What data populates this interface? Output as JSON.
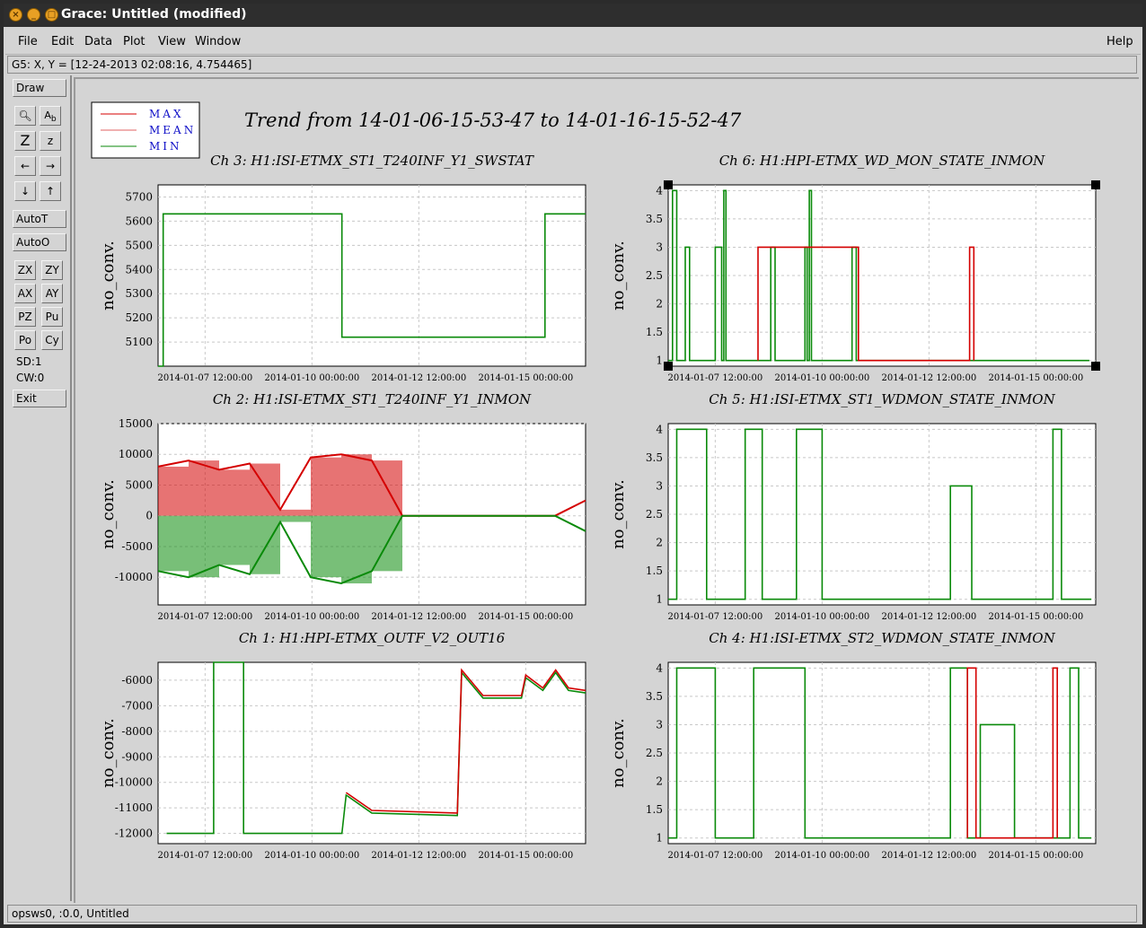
{
  "window": {
    "title": "Grace: Untitled (modified)"
  },
  "menubar": {
    "items": [
      {
        "label": "File",
        "key": "file"
      },
      {
        "label": "Edit",
        "key": "edit"
      },
      {
        "label": "Data",
        "key": "data"
      },
      {
        "label": "Plot",
        "key": "plot"
      },
      {
        "label": "View",
        "key": "view"
      },
      {
        "label": "Window",
        "key": "window"
      }
    ],
    "help": "Help"
  },
  "locator": {
    "text": "G5: X, Y = [12-24-2013 02:08:16, 4.754465]"
  },
  "toolbox": {
    "draw": "Draw",
    "autoT": "AutoT",
    "autoO": "AutoO",
    "grid_buttons": [
      "ZX",
      "ZY",
      "AX",
      "AY",
      "PZ",
      "Pu",
      "Po",
      "Cy"
    ],
    "sd": "SD:1",
    "cw": "CW:0",
    "exit": "Exit",
    "icons": [
      "zoom-icon",
      "text-label-icon",
      "zoom-in-icon",
      "zoom-out-icon",
      "pan-left-icon",
      "pan-right-icon",
      "pan-down-icon",
      "pan-up-icon"
    ]
  },
  "status": {
    "text": "opsws0, :0.0, Untitled"
  },
  "legend": {
    "entries": [
      {
        "name": "MAX",
        "color": "#d40000"
      },
      {
        "name": "MEAN",
        "color": "#e06060"
      },
      {
        "name": "MIN",
        "color": "#0a8a0a"
      }
    ]
  },
  "page_title": "Trend from 14-01-06-15-53-47 to 14-01-16-15-52-47",
  "chart_data": [
    {
      "type": "line",
      "title": "Ch 3: H1:ISI-ETMX_ST1_T240INF_Y1_SWSTAT",
      "ylabel": "no_conv.",
      "ylim": [
        5000,
        5750
      ],
      "yticks": [
        "5700",
        "5600",
        "5500",
        "5400",
        "5300",
        "5200",
        "5100"
      ],
      "xticks": [
        "2014-01-07 12:00:00",
        "2014-01-10 00:00:00",
        "2014-01-12 12:00:00",
        "2014-01-15 00:00:00"
      ],
      "series": [
        {
          "name": "MIN",
          "points": [
            [
              0,
              5000
            ],
            [
              0.012,
              5000
            ],
            [
              0.012,
              5630
            ],
            [
              0.43,
              5630
            ],
            [
              0.43,
              5120
            ],
            [
              0.905,
              5120
            ],
            [
              0.905,
              5630
            ],
            [
              1,
              5630
            ]
          ]
        }
      ]
    },
    {
      "type": "line",
      "title": "Ch 6: H1:HPI-ETMX_WD_MON_STATE_INMON",
      "ylabel": "no_conv.",
      "ylim": [
        0.9,
        4.1
      ],
      "yticks": [
        "4",
        "3.5",
        "3",
        "2.5",
        "2",
        "1.5",
        "1"
      ],
      "xticks": [
        "2014-01-07 12:00:00",
        "2014-01-10 00:00:00",
        "2014-01-12 12:00:00",
        "2014-01-15 00:00:00"
      ],
      "series": [
        {
          "name": "MIN",
          "points": [
            [
              0,
              1
            ],
            [
              0.01,
              1
            ],
            [
              0.01,
              4
            ],
            [
              0.02,
              4
            ],
            [
              0.02,
              1
            ],
            [
              0.04,
              1
            ],
            [
              0.04,
              3
            ],
            [
              0.05,
              3
            ],
            [
              0.05,
              1
            ],
            [
              0.11,
              1
            ],
            [
              0.11,
              3
            ],
            [
              0.125,
              3
            ],
            [
              0.125,
              1
            ],
            [
              0.13,
              1
            ],
            [
              0.13,
              4
            ],
            [
              0.135,
              4
            ],
            [
              0.135,
              1
            ],
            [
              0.24,
              1
            ],
            [
              0.24,
              3
            ],
            [
              0.25,
              3
            ],
            [
              0.25,
              1
            ],
            [
              0.32,
              1
            ],
            [
              0.32,
              3
            ],
            [
              0.325,
              3
            ],
            [
              0.325,
              1
            ],
            [
              0.33,
              1
            ],
            [
              0.33,
              4
            ],
            [
              0.335,
              4
            ],
            [
              0.335,
              1
            ],
            [
              0.43,
              1
            ],
            [
              0.43,
              3
            ],
            [
              0.44,
              3
            ],
            [
              0.44,
              1
            ],
            [
              0.985,
              1
            ]
          ]
        },
        {
          "name": "MAX",
          "points": [
            [
              0.21,
              1
            ],
            [
              0.21,
              3
            ],
            [
              0.445,
              3
            ],
            [
              0.445,
              1
            ],
            [
              0.705,
              1
            ],
            [
              0.705,
              3
            ],
            [
              0.715,
              3
            ],
            [
              0.715,
              1
            ]
          ]
        }
      ]
    },
    {
      "type": "line",
      "title": "Ch 2: H1:ISI-ETMX_ST1_T240INF_Y1_INMON",
      "ylabel": "no_conv.",
      "ylim": [
        -14500,
        15000
      ],
      "yticks": [
        "15000",
        "10000",
        "5000",
        "0",
        "-5000",
        "-10000"
      ],
      "xticks": [
        "2014-01-07 12:00:00",
        "2014-01-10 00:00:00",
        "2014-01-12 12:00:00",
        "2014-01-15 00:00:00"
      ],
      "series": [
        {
          "name": "MAX",
          "values": [
            8000,
            9000,
            7500,
            8500,
            1000,
            9500,
            10000,
            9000,
            0,
            0,
            0,
            0,
            0,
            0,
            2500
          ]
        },
        {
          "name": "MIN",
          "values": [
            -9000,
            -10000,
            -8000,
            -9500,
            -1000,
            -10000,
            -11000,
            -9000,
            0,
            0,
            0,
            0,
            0,
            0,
            -2500
          ]
        }
      ]
    },
    {
      "type": "line",
      "title": "Ch 5: H1:ISI-ETMX_ST1_WDMON_STATE_INMON",
      "ylabel": "no_conv.",
      "ylim": [
        0.9,
        4.1
      ],
      "yticks": [
        "4",
        "3.5",
        "3",
        "2.5",
        "2",
        "1.5",
        "1"
      ],
      "xticks": [
        "2014-01-07 12:00:00",
        "2014-01-10 00:00:00",
        "2014-01-12 12:00:00",
        "2014-01-15 00:00:00"
      ],
      "series": [
        {
          "name": "MIN",
          "points": [
            [
              0,
              1
            ],
            [
              0.02,
              1
            ],
            [
              0.02,
              4
            ],
            [
              0.09,
              4
            ],
            [
              0.09,
              1
            ],
            [
              0.18,
              1
            ],
            [
              0.18,
              4
            ],
            [
              0.22,
              4
            ],
            [
              0.22,
              1
            ],
            [
              0.3,
              1
            ],
            [
              0.3,
              4
            ],
            [
              0.36,
              4
            ],
            [
              0.36,
              1
            ],
            [
              0.66,
              1
            ],
            [
              0.66,
              3
            ],
            [
              0.71,
              3
            ],
            [
              0.71,
              1
            ],
            [
              0.9,
              1
            ],
            [
              0.9,
              4
            ],
            [
              0.92,
              4
            ],
            [
              0.92,
              1
            ],
            [
              0.99,
              1
            ]
          ]
        }
      ]
    },
    {
      "type": "line",
      "title": "Ch 1: H1:HPI-ETMX_OUTF_V2_OUT16",
      "ylabel": "no_conv.",
      "ylim": [
        -12400,
        -5300
      ],
      "yticks": [
        "-6000",
        "-7000",
        "-8000",
        "-9000",
        "-10000",
        "-11000",
        "-12000"
      ],
      "xticks": [
        "2014-01-07 12:00:00",
        "2014-01-10 00:00:00",
        "2014-01-12 12:00:00",
        "2014-01-15 00:00:00"
      ],
      "series": [
        {
          "name": "MIN",
          "points": [
            [
              0.02,
              -12000
            ],
            [
              0.13,
              -12000
            ],
            [
              0.13,
              -5300
            ],
            [
              0.2,
              -5300
            ],
            [
              0.2,
              -12000
            ],
            [
              0.43,
              -12000
            ],
            [
              0.44,
              -10500
            ],
            [
              0.5,
              -11200
            ],
            [
              0.7,
              -11300
            ],
            [
              0.71,
              -5700
            ],
            [
              0.76,
              -6700
            ],
            [
              0.85,
              -6700
            ],
            [
              0.86,
              -5900
            ],
            [
              0.9,
              -6400
            ],
            [
              0.93,
              -5700
            ],
            [
              0.96,
              -6400
            ],
            [
              1,
              -6500
            ]
          ]
        },
        {
          "name": "MAX",
          "points": [
            [
              0.44,
              -10400
            ],
            [
              0.5,
              -11100
            ],
            [
              0.7,
              -11200
            ],
            [
              0.71,
              -5600
            ],
            [
              0.76,
              -6600
            ],
            [
              0.85,
              -6600
            ],
            [
              0.86,
              -5800
            ],
            [
              0.9,
              -6300
            ],
            [
              0.93,
              -5600
            ],
            [
              0.96,
              -6300
            ],
            [
              1,
              -6400
            ]
          ]
        }
      ]
    },
    {
      "type": "line",
      "title": "Ch 4: H1:ISI-ETMX_ST2_WDMON_STATE_INMON",
      "ylabel": "no_conv.",
      "ylim": [
        0.9,
        4.1
      ],
      "yticks": [
        "4",
        "3.5",
        "3",
        "2.5",
        "2",
        "1.5",
        "1"
      ],
      "xticks": [
        "2014-01-07 12:00:00",
        "2014-01-10 00:00:00",
        "2014-01-12 12:00:00",
        "2014-01-15 00:00:00"
      ],
      "series": [
        {
          "name": "MIN",
          "points": [
            [
              0,
              1
            ],
            [
              0.02,
              1
            ],
            [
              0.02,
              4
            ],
            [
              0.11,
              4
            ],
            [
              0.11,
              1
            ],
            [
              0.2,
              1
            ],
            [
              0.2,
              4
            ],
            [
              0.32,
              4
            ],
            [
              0.32,
              1
            ],
            [
              0.66,
              1
            ],
            [
              0.66,
              4
            ],
            [
              0.7,
              4
            ],
            [
              0.7,
              1
            ],
            [
              0.73,
              1
            ],
            [
              0.73,
              3
            ],
            [
              0.81,
              3
            ],
            [
              0.81,
              1
            ],
            [
              0.94,
              1
            ],
            [
              0.94,
              4
            ],
            [
              0.96,
              4
            ],
            [
              0.96,
              1
            ],
            [
              0.99,
              1
            ]
          ]
        },
        {
          "name": "MAX",
          "points": [
            [
              0.7,
              1
            ],
            [
              0.7,
              4
            ],
            [
              0.72,
              4
            ],
            [
              0.72,
              1
            ],
            [
              0.9,
              1
            ],
            [
              0.9,
              4
            ],
            [
              0.91,
              4
            ],
            [
              0.91,
              1
            ]
          ]
        }
      ]
    }
  ]
}
